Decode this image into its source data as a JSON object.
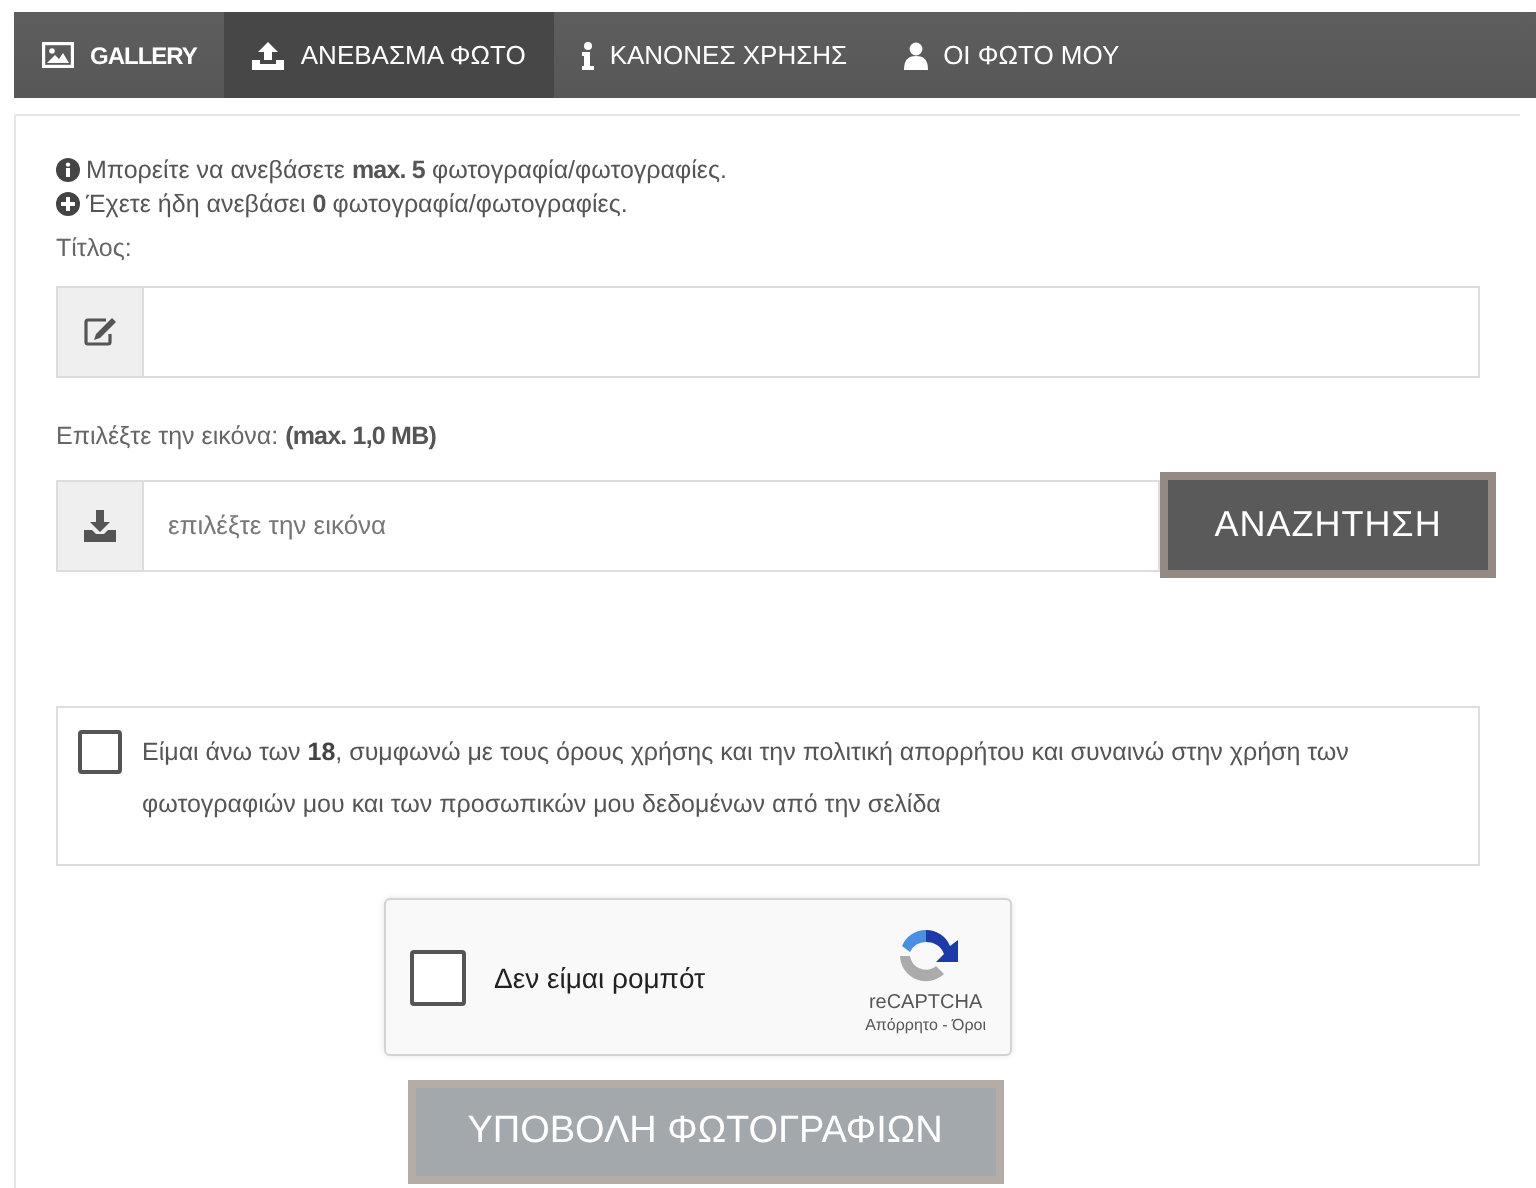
{
  "tabs": [
    {
      "label": "GALLERY",
      "kind": "gallery",
      "selected": false
    },
    {
      "label": "ΑΝΕΒΑΣΜΑ ΦΩΤΟ",
      "kind": "upload",
      "selected": true
    },
    {
      "label": "ΚΑΝΟΝΕΣ ΧΡΗΣΗΣ",
      "kind": "rules",
      "selected": false
    },
    {
      "label": "ΟΙ ΦΩΤΟ ΜΟΥ",
      "kind": "account",
      "selected": false
    }
  ],
  "notices": [
    {
      "kind": "limit",
      "text": "Μπορείτε να ανεβάσετε **max. 5** φωτογραφία/φωτογραφίες."
    },
    {
      "kind": "count",
      "text": "Έχετε ήδη ανεβάσει **0** φωτογραφία/φωτογραφίες."
    }
  ],
  "title_field": {
    "label": "Τίτλος:"
  },
  "image_field": {
    "label": "Επιλέξτε την εικόνα: **(max. 1,0 MB)**",
    "placeholder": "επιλέξτε την εικόνα",
    "button": "ΑΝΑΖΗΤΗΣΗ"
  },
  "consent": {
    "checked": false,
    "text": "Είμαι άνω των **18**, συμφωνώ με τους όρους χρήσης και την πολιτική απορρήτου και συναινώ στην χρήση των φωτογραφιών μου και των προσωπικών μου δεδομένων από την σελίδα"
  },
  "captcha": {
    "checked": false,
    "label": "Δεν είμαι ρομπότ",
    "brand": "reCAPTCHA",
    "links": "Απόρρητο - Όροι"
  },
  "submit": {
    "label": "ΥΠΟΒΟΛΗ ΦΩΤΟΓΡΑΦΙΩΝ"
  }
}
